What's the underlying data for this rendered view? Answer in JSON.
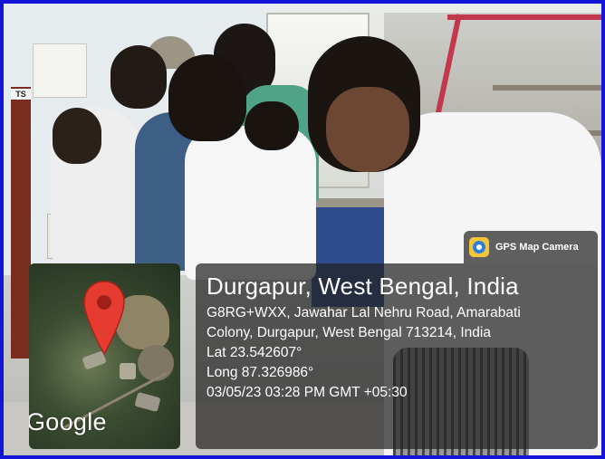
{
  "photo": {
    "door_sign_text": "TS"
  },
  "gps_badge": {
    "app_icon": "gps-map-camera-icon",
    "label": "GPS Map Camera"
  },
  "location": {
    "title": "Durgapur, West Bengal, India",
    "address_line_1": "G8RG+WXX, Jawahar Lal Nehru Road, Amarabati",
    "address_line_2": "Colony, Durgapur, West Bengal 713214, India",
    "latitude": "Lat 23.542607°",
    "longitude": "Long 87.326986°",
    "timestamp": "03/05/23 03:28 PM GMT +05:30"
  },
  "map": {
    "pin_icon": "map-pin-icon",
    "provider_logo": "Google",
    "pin_color": "#e53b30"
  },
  "colors": {
    "frame_border": "#1414d8",
    "panel_background": "rgba(34,34,34,0.72)",
    "text": "#ffffff"
  }
}
